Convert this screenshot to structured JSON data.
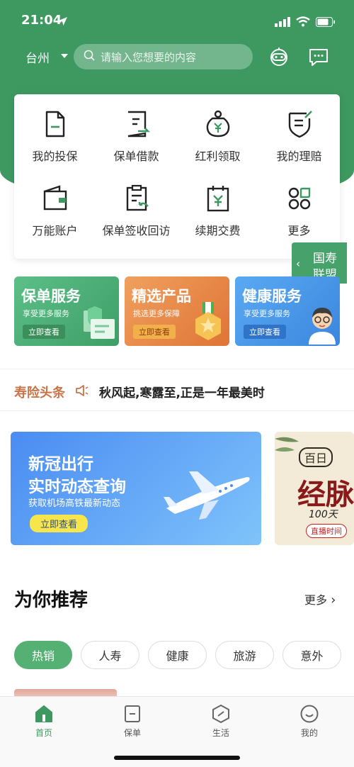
{
  "status": {
    "time": "21:04"
  },
  "topbar": {
    "city": "台州",
    "search_placeholder": "请输入您想要的内容"
  },
  "quick_menu": [
    {
      "label": "我的投保",
      "icon": "policy-doc-icon"
    },
    {
      "label": "保单借款",
      "icon": "loan-doc-icon"
    },
    {
      "label": "红利领取",
      "icon": "money-bag-icon"
    },
    {
      "label": "我的理赔",
      "icon": "claim-shield-icon"
    },
    {
      "label": "万能账户",
      "icon": "wallet-icon"
    },
    {
      "label": "保单签收回访",
      "icon": "clipboard-return-icon"
    },
    {
      "label": "续期交费",
      "icon": "calendar-yen-icon"
    },
    {
      "label": "更多",
      "icon": "more-grid-icon"
    }
  ],
  "float_tab": {
    "line1": "国寿",
    "line2": "联盟"
  },
  "services": [
    {
      "title": "保单服务",
      "subtitle": "享受更多服务",
      "button": "立即查看",
      "color": "#4fb07a"
    },
    {
      "title": "精选产品",
      "subtitle": "挑选更多保障",
      "button": "立即查看",
      "color": "#e3803f"
    },
    {
      "title": "健康服务",
      "subtitle": "享受更多服务",
      "button": "立即查看",
      "color": "#3f93e6"
    }
  ],
  "news": {
    "tag": "寿险头条",
    "text": "秋风起,寒露至,正是一年最美时"
  },
  "banner": {
    "line1": "新冠出行",
    "line2": "实时动态查询",
    "line3": "获取机场高铁最新动态",
    "button": "立即查看"
  },
  "banner2": {
    "badge": "百日",
    "title": "经脉",
    "sub": "100天",
    "live": "直播时间"
  },
  "recommend": {
    "title": "为你推荐",
    "more": "更多",
    "chips": [
      "热销",
      "人寿",
      "健康",
      "旅游",
      "意外"
    ],
    "active_chip": 0
  },
  "tabbar": [
    {
      "label": "首页",
      "icon": "home-icon"
    },
    {
      "label": "保单",
      "icon": "policy-icon"
    },
    {
      "label": "生活",
      "icon": "life-icon"
    },
    {
      "label": "我的",
      "icon": "profile-icon"
    }
  ],
  "colors": {
    "primary": "#3d9960",
    "news_tag": "#c87448"
  }
}
